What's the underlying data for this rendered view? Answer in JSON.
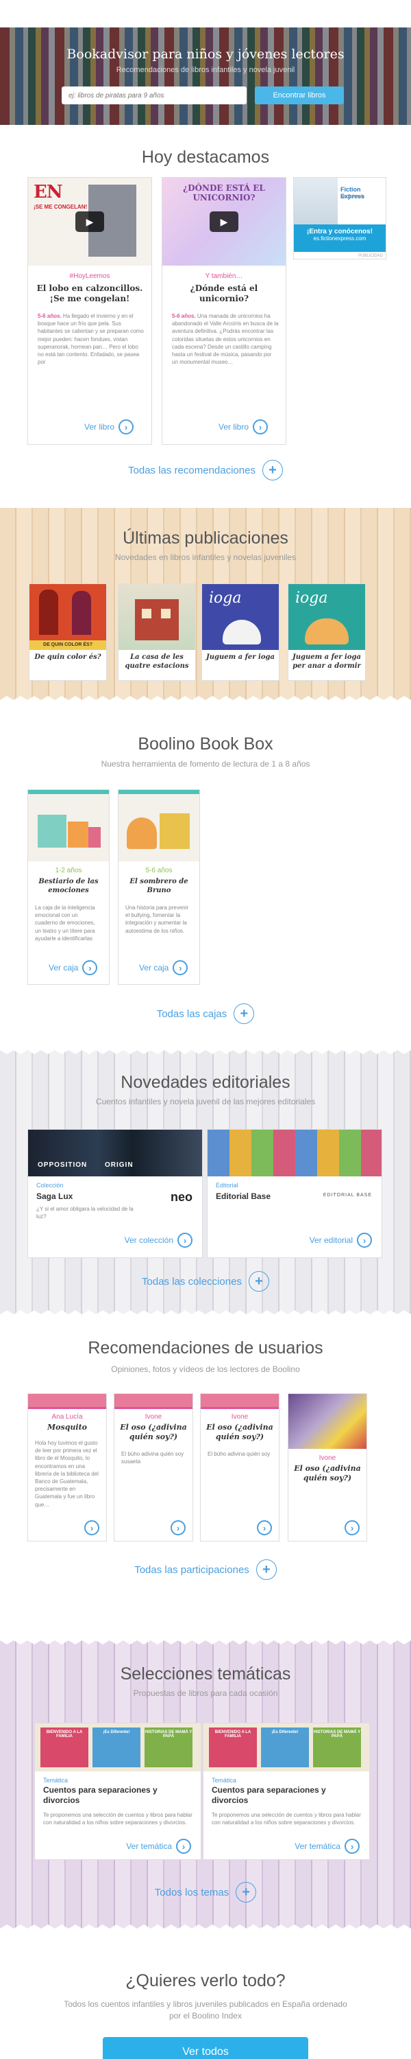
{
  "hero": {
    "title": "Bookadvisor para niños y jóvenes lectores",
    "subtitle": "Recomendaciones de libros infantiles y novela juvenil",
    "placeholder": "ej: libros de piratas para 9 años",
    "button": "Encontrar libros"
  },
  "featured": {
    "title": "Hoy destacamos",
    "cards": [
      {
        "tag": "#HoyLeemos",
        "title": "El lobo en calzoncillos. ¡Se me congelan!",
        "age": "5-6 años.",
        "text": "Ha llegado el invierno y en el bosque hace un frío que pela. Sus habitantes se calientan y se preparan como mejor pueden: hacen fondues, vistan superanorak, hornean pan… Pero el lobo no está tan contento. Enfadado, se pasea por",
        "more": "Ver libro",
        "cover_title": "¡SE ME CONGELAN!"
      },
      {
        "tag": "Y también…",
        "title": "¿Dónde está el unicornio?",
        "age": "5-6 años.",
        "text": "Una manada de unicornios ha abandonado el Valle Arcoíris en busca de la aventura definitiva. ¿Podrás encontrar las coloridas siluetas de estos unicornios en cada escena? Desde un castillo camping hasta un festival de música, pasando por un monumental museo…",
        "more": "Ver libro",
        "cover_title": "¿DÓNDE ESTÁ EL UNICORNIO?"
      }
    ],
    "ad": {
      "brand": "Fiction Express",
      "brand_sub": "for Schools",
      "cta": "¡Entra y conócenos!",
      "url": "es.fictionexpress.com",
      "label": "PUBLICIDAD"
    },
    "all": "Todas las recomendaciones"
  },
  "latest": {
    "title": "Últimas publicaciones",
    "subtitle": "Novedades en libros infantiles y novelas juveniles",
    "books": [
      "De quin color és?",
      "La casa de les quatre estacions",
      "Juguem a fer ioga",
      "Juguem a fer ioga per anar a dormir"
    ],
    "cover_texts": [
      "DE QUIN COLOR ÉS?",
      "",
      "ioga",
      "ioga"
    ]
  },
  "bookbox": {
    "title": "Boolino Book Box",
    "subtitle": "Nuestra herramienta de fomento de lectura de 1 a 8 años",
    "boxes": [
      {
        "age": "1-2 años",
        "title": "Bestiario de las emociones",
        "text": "La caja de la inteligencia emocional con un cuaderno de emociones, un teatro y un títere para ayudarle a identificarlas",
        "more": "Ver caja"
      },
      {
        "age": "5-6 años",
        "title": "El sombrero de Bruno",
        "text": "Una historia para prevenir el bullying, fomentar la integración y aumentar la autoestima de los niños.",
        "more": "Ver caja"
      }
    ],
    "all": "Todas las cajas"
  },
  "editorial": {
    "title": "Novedades editoriales",
    "subtitle": "Cuentos infantiles y novela juvenil de las mejores editoriales",
    "items": [
      {
        "cat": "Colección",
        "name": "Saga Lux",
        "text": "¿Y si el amor obligara la velocidad de la luz?",
        "logo": "neo",
        "more": "Ver colección",
        "img_a": "OPPOSITION",
        "img_b": "ORIGIN"
      },
      {
        "cat": "Editorial",
        "name": "Editorial Base",
        "text": "",
        "logo": "EDITORIAL BASE",
        "more": "Ver editorial",
        "img_a": "",
        "img_b": ""
      }
    ],
    "all": "Todas las colecciones"
  },
  "users": {
    "title": "Recomendaciones de usuarios",
    "subtitle": "Opiniones, fotos y vídeos de los lectores de Boolino",
    "items": [
      {
        "user": "Ana Lucía",
        "title": "Mosquito",
        "text": "Hola hoy tuvimos el gusto de leer por primera vez el libro de el Mosquito, lo encontramos en una librería de la biblioteca del Banco de Guatemala, precisamente en Guatemala y fue un libro que…"
      },
      {
        "user": "Ivone",
        "title": "El oso (¿adivina quién soy?)",
        "text": "El búho adivina quién soy susaeta"
      },
      {
        "user": "Ivone",
        "title": "El oso (¿adivina quién soy?)",
        "text": "El búho adivina quién soy"
      },
      {
        "user": "Ivone",
        "title": "El oso (¿adivina quién soy?)",
        "text": ""
      }
    ],
    "all": "Todas las participaciones"
  },
  "themes": {
    "title": "Selecciones temáticas",
    "subtitle": "Propuestas de libros para cada ocasión",
    "items": [
      {
        "cat": "Temática",
        "title": "Cuentos para separaciones y divorcios",
        "text": "Te proponemos una selección de cuentos y libros para hablar con naturalidad a los niños sobre separaciones y divorcios.",
        "more": "Ver temática"
      },
      {
        "cat": "Temática",
        "title": "Cuentos para separaciones y divorcios",
        "text": "Te proponemos una selección de cuentos y libros para hablar con naturalidad a los niños sobre separaciones y divorcios.",
        "more": "Ver temática"
      }
    ],
    "books": [
      "BIENVENIDO A LA FAMILIA",
      "¡Es Diferente!",
      "HISTORIAS DE MAMÁ Y PAPÁ"
    ],
    "all": "Todos los temas"
  },
  "cta": {
    "title": "¿Quieres verlo todo?",
    "subtitle": "Todos los cuentos infantiles y libros juveniles publicados en España ordenado por el Boolino Index",
    "button": "Ver todos"
  },
  "colors": {
    "accent": "#4a9fe0",
    "pink": "#e0539a"
  }
}
